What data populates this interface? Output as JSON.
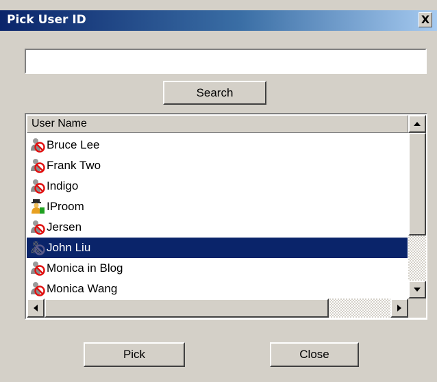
{
  "window": {
    "title": "Pick User ID",
    "close_label": "X"
  },
  "search": {
    "value": "",
    "button_label": "Search"
  },
  "list": {
    "column_header": "User Name",
    "items": [
      {
        "label": "Bruce Lee",
        "icon": "user-disabled-icon",
        "selected": false
      },
      {
        "label": "Frank Two",
        "icon": "user-disabled-icon",
        "selected": false
      },
      {
        "label": "Indigo",
        "icon": "user-disabled-icon",
        "selected": false
      },
      {
        "label": "IProom",
        "icon": "user-active-icon",
        "selected": false
      },
      {
        "label": "Jersen",
        "icon": "user-disabled-icon",
        "selected": false
      },
      {
        "label": "John Liu",
        "icon": "user-selected-icon",
        "selected": true
      },
      {
        "label": "Monica in Blog",
        "icon": "user-disabled-icon",
        "selected": false
      },
      {
        "label": "Monica Wang",
        "icon": "user-disabled-icon",
        "selected": false
      }
    ]
  },
  "buttons": {
    "pick_label": "Pick",
    "close_label": "Close"
  },
  "colors": {
    "title_gradient_start": "#0a246a",
    "title_gradient_end": "#a6caf0",
    "selection": "#0a246a",
    "dialog_bg": "#d4d0c8"
  }
}
